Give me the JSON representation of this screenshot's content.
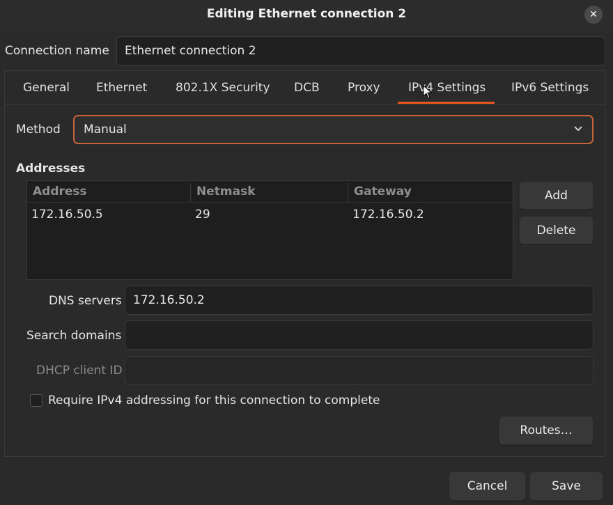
{
  "window": {
    "title": "Editing Ethernet connection 2",
    "close_glyph": "✕"
  },
  "connection_name": {
    "label": "Connection name",
    "value": "Ethernet connection 2"
  },
  "tabs": [
    {
      "label": "General"
    },
    {
      "label": "Ethernet"
    },
    {
      "label": "802.1X Security"
    },
    {
      "label": "DCB"
    },
    {
      "label": "Proxy"
    },
    {
      "label": "IPv4 Settings",
      "active": true
    },
    {
      "label": "IPv6 Settings"
    }
  ],
  "method": {
    "label": "Method",
    "value": "Manual"
  },
  "addresses": {
    "heading": "Addresses",
    "columns": [
      "Address",
      "Netmask",
      "Gateway"
    ],
    "rows": [
      [
        "172.16.50.5",
        "29",
        "172.16.50.2"
      ]
    ],
    "add_label": "Add",
    "delete_label": "Delete"
  },
  "dns": {
    "label": "DNS servers",
    "value": "172.16.50.2"
  },
  "search_domains": {
    "label": "Search domains",
    "value": ""
  },
  "dhcp_client_id": {
    "label": "DHCP client ID",
    "value": ""
  },
  "require_ipv4": {
    "label": "Require IPv4 addressing for this connection to complete",
    "checked": false
  },
  "routes_label": "Routes…",
  "footer": {
    "cancel_label": "Cancel",
    "save_label": "Save"
  },
  "colors": {
    "accent": "#e95420",
    "focus_border": "#c7643a",
    "background": "#2a2a2a",
    "entry": "#202020"
  }
}
